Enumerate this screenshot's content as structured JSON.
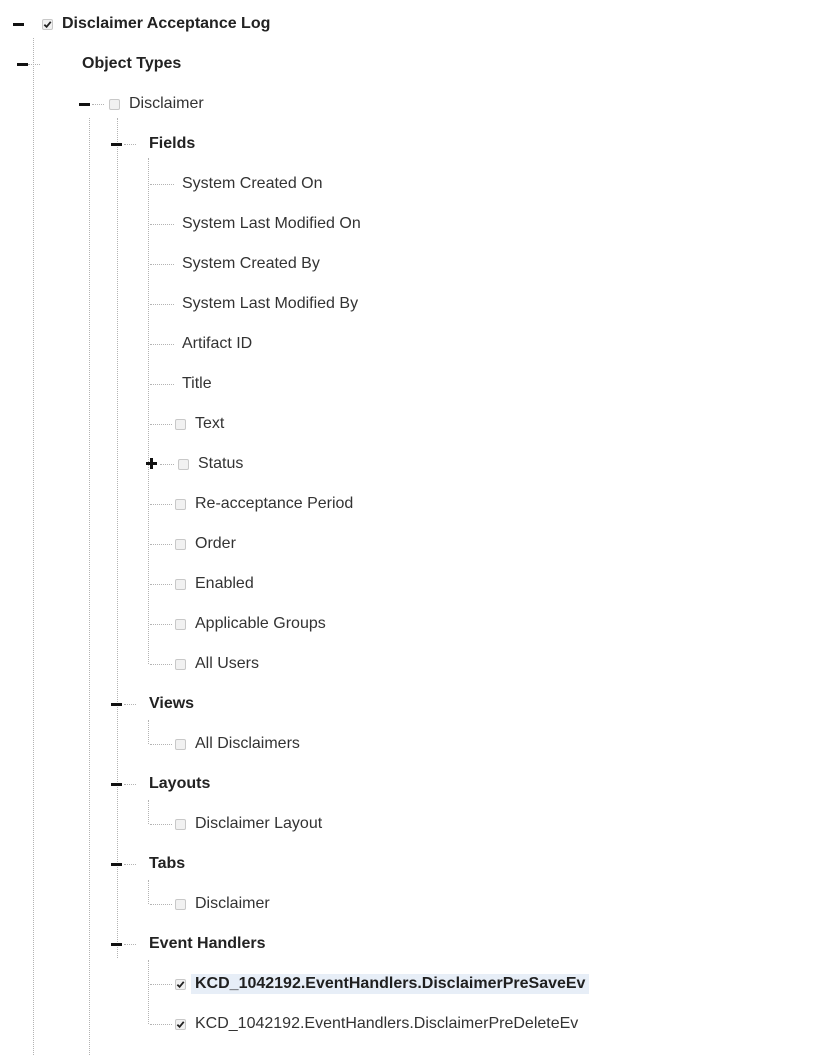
{
  "tree": {
    "root": {
      "label": "Disclaimer Acceptance Log",
      "checked": true
    },
    "object_types": {
      "label": "Object Types"
    },
    "disclaimer": {
      "label": "Disclaimer",
      "checked": false
    },
    "groups": {
      "fields": {
        "label": "Fields"
      },
      "views": {
        "label": "Views"
      },
      "layouts": {
        "label": "Layouts"
      },
      "tabs": {
        "label": "Tabs"
      },
      "event_handlers": {
        "label": "Event Handlers"
      }
    },
    "fields": [
      {
        "label": "System Created On"
      },
      {
        "label": "System Last Modified On"
      },
      {
        "label": "System Created By"
      },
      {
        "label": "System Last Modified By"
      },
      {
        "label": "Artifact ID"
      },
      {
        "label": "Title"
      },
      {
        "label": "Text",
        "checked": false
      },
      {
        "label": "Status",
        "checked": false,
        "expandable": true
      },
      {
        "label": "Re-acceptance Period",
        "checked": false
      },
      {
        "label": "Order",
        "checked": false
      },
      {
        "label": "Enabled",
        "checked": false
      },
      {
        "label": "Applicable Groups",
        "checked": false
      },
      {
        "label": "All Users",
        "checked": false
      }
    ],
    "views": [
      {
        "label": "All Disclaimers",
        "checked": false
      }
    ],
    "layouts": [
      {
        "label": "Disclaimer Layout",
        "checked": false
      }
    ],
    "tabs": [
      {
        "label": "Disclaimer",
        "checked": false
      }
    ],
    "event_handlers": [
      {
        "label": "KCD_1042192.EventHandlers.DisclaimerPreSaveEv",
        "checked": true,
        "selected": true
      },
      {
        "label": "KCD_1042192.EventHandlers.DisclaimerPreDeleteEv",
        "checked": true
      }
    ]
  }
}
